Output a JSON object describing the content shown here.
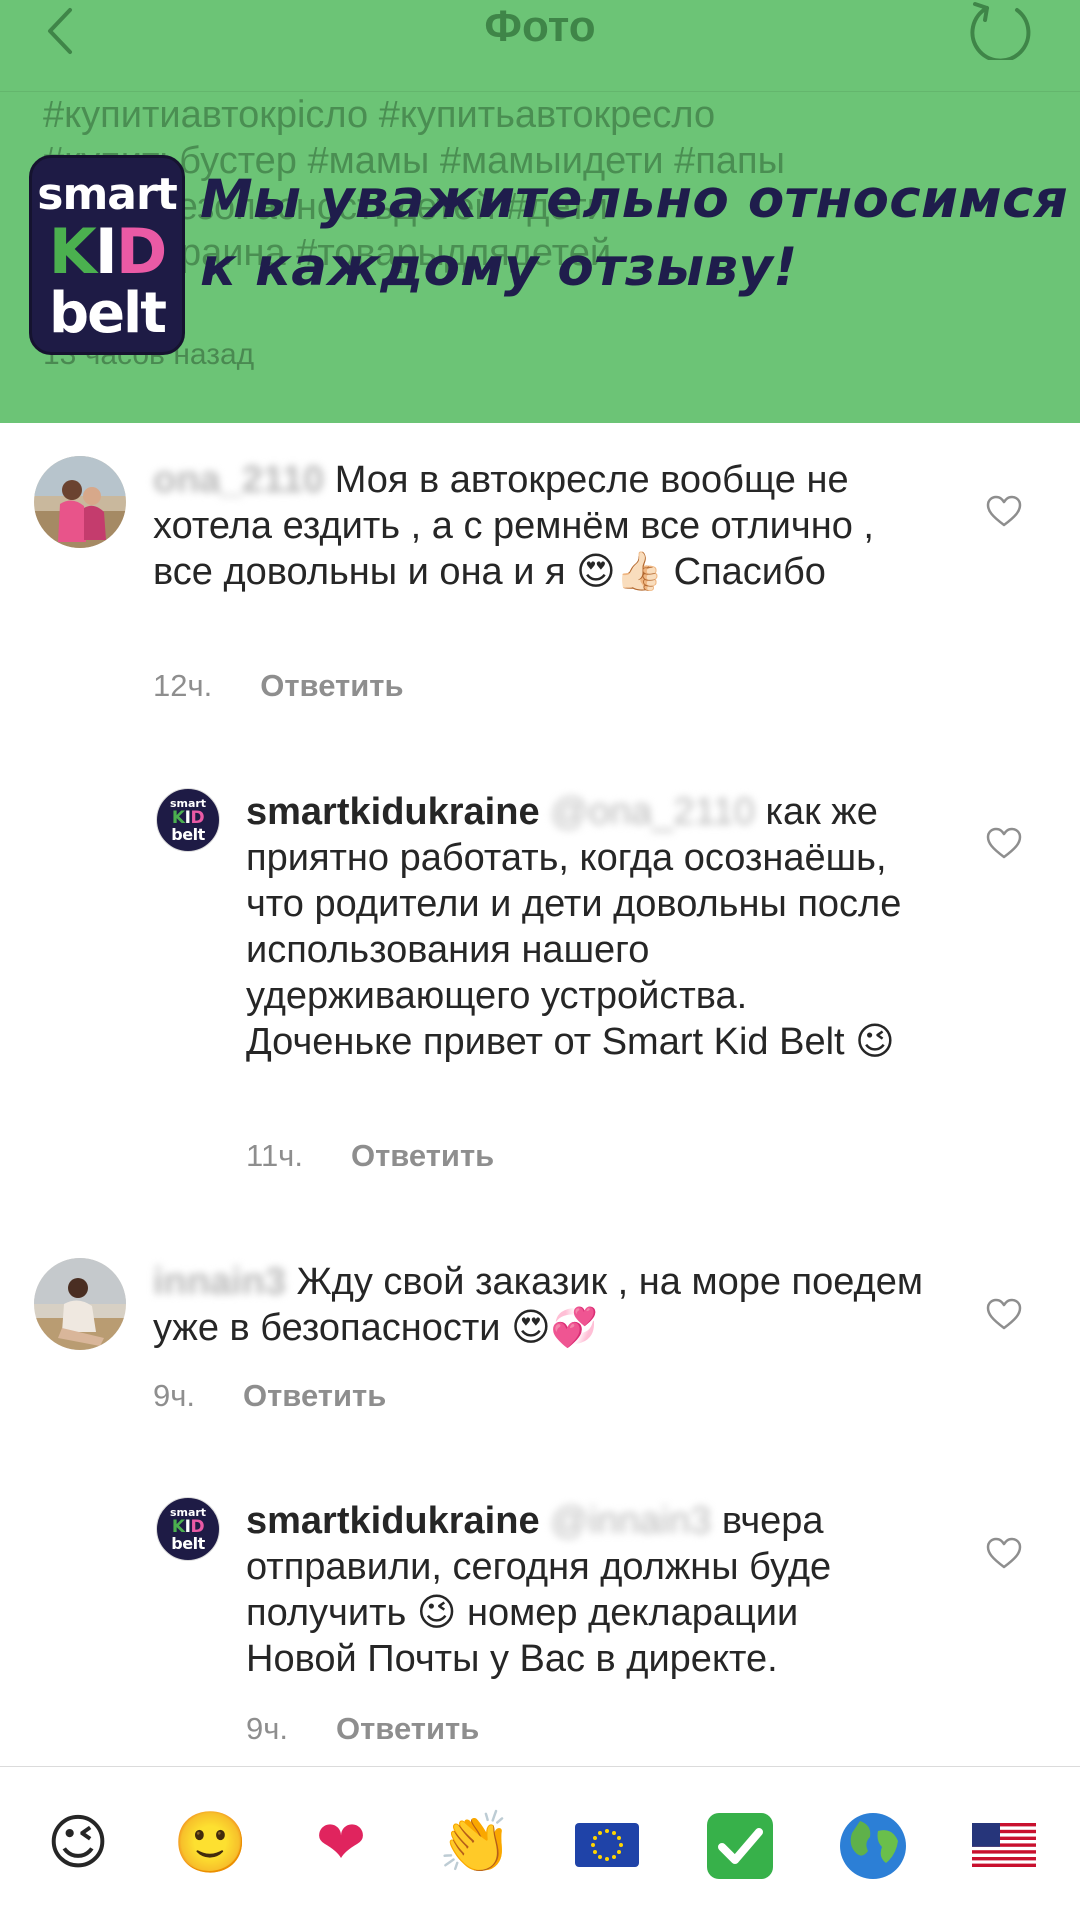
{
  "nav": {
    "title": "Фото",
    "back_icon": "chevron-left-icon",
    "refresh_icon": "refresh-icon"
  },
  "post": {
    "caption": "#купитиавтокрісло #купитьавтокресло\n#купитьбустер #мамы #мамыидети #папы\nдети #безопасностьдетей #дети\nдетейукраина #товарыдлядетей\nок",
    "time": "13 часов назад"
  },
  "promo": {
    "logo_line1": "smart",
    "logo_k": "K",
    "logo_i": "I",
    "logo_d": "D",
    "logo_line3": "belt",
    "text": "Мы уважительно относимся\nк каждому отзыву!"
  },
  "comments": [
    {
      "username": "ona_2110",
      "text": "Моя в автокресле вообще не хотела ездить , а с ремнём все отлично , все довольны и она и я 😍👍🏻 Спасибо",
      "time": "12ч.",
      "reply_label": "Ответить"
    },
    {
      "username": "smartkidukraine",
      "mention": "@ona_2110",
      "text": "как же приятно работать, когда осознаёшь, что родители и дети довольны после использования нашего удерживающего устройства. Доченьке привет от Smart Kid Belt 😉",
      "time": "11ч.",
      "reply_label": "Ответить"
    },
    {
      "username": "innain3",
      "text": "Жду свой заказик , на море поедем уже в безопасности 😍💞",
      "time": "9ч.",
      "reply_label": "Ответить"
    },
    {
      "username": "smartkidukraine",
      "mention": "@innain3",
      "text": "вчера отправили, сегодня должны буде получить 😉 номер декларации Новой Почты у Вас в директе.",
      "time": "9ч.",
      "reply_label": "Ответить"
    }
  ],
  "emoji_bar": {
    "items": [
      "😉",
      "🙂",
      "❤",
      "👏",
      "🇪🇺",
      "✅",
      "🌍",
      "🇺🇸"
    ],
    "names": [
      "wink-emoji",
      "smile-emoji",
      "heart-emoji",
      "clap-emoji",
      "eu-flag-emoji",
      "check-emoji",
      "globe-emoji",
      "us-flag-emoji"
    ]
  },
  "colors": {
    "header_green": "#6cc476",
    "logo_navy": "#1e1b45",
    "logo_green": "#4bb04f",
    "logo_pink": "#ea5aa5"
  }
}
